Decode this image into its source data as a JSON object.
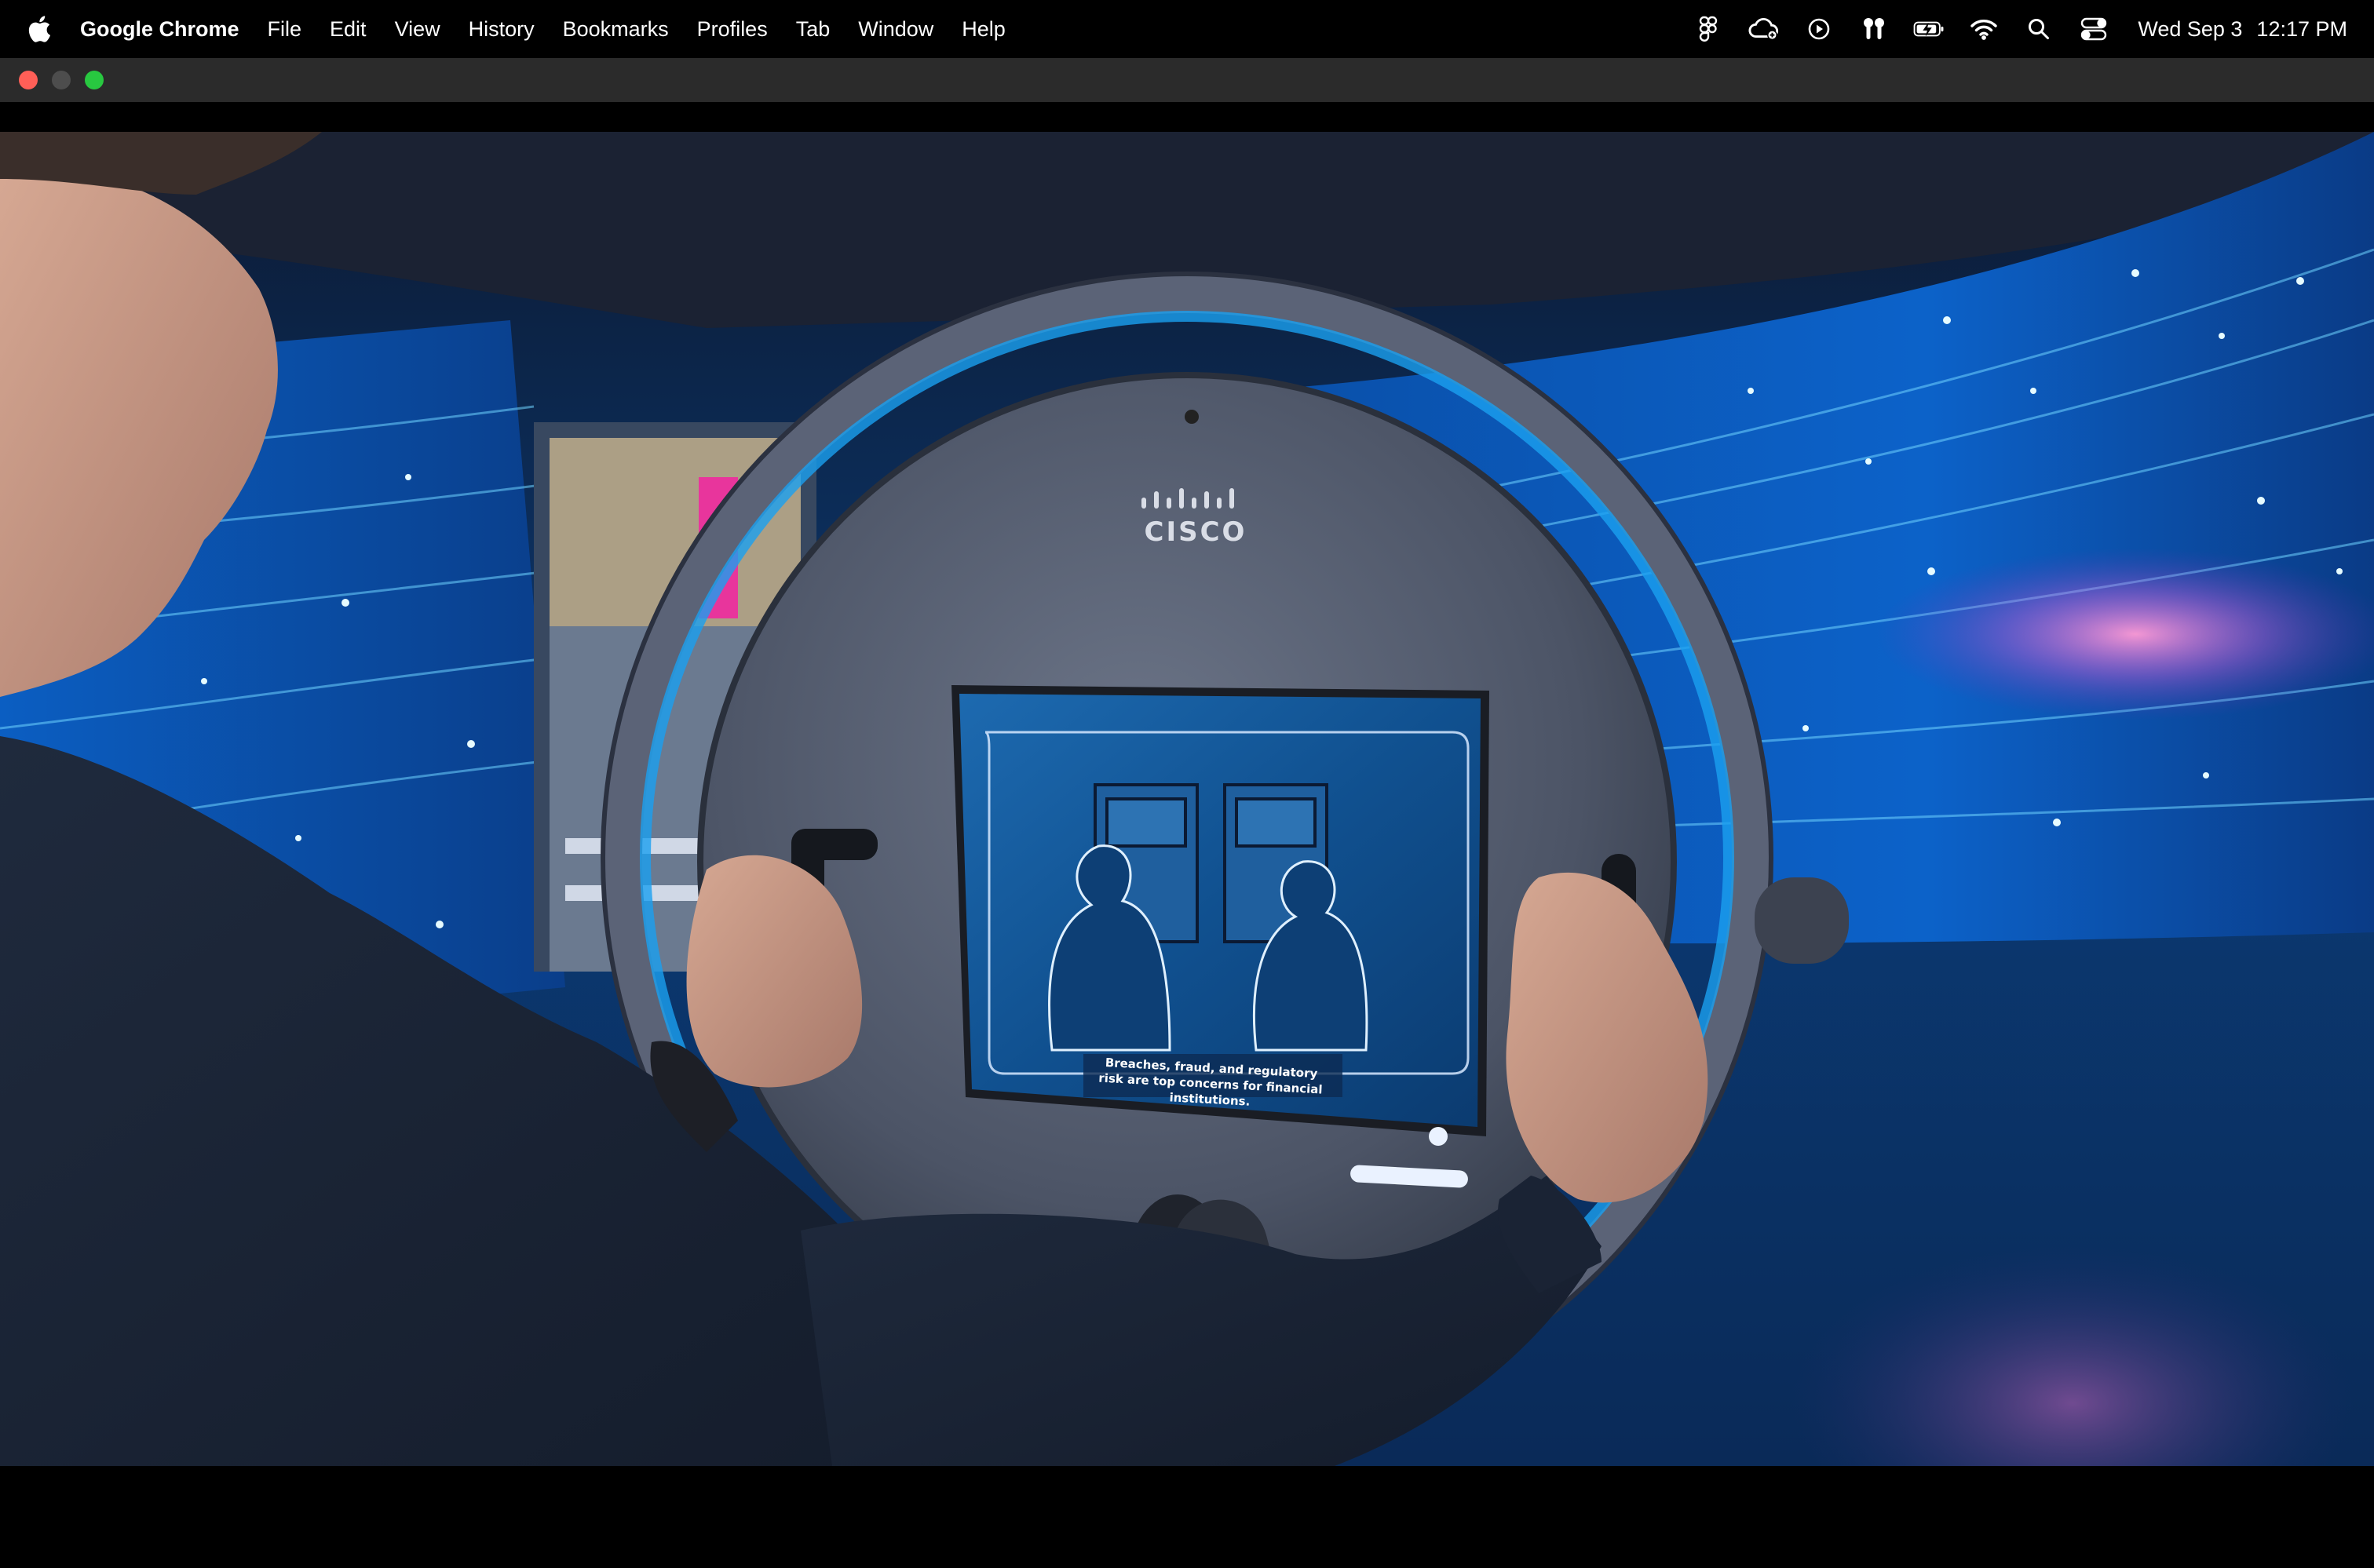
{
  "menubar": {
    "app_name": "Google Chrome",
    "menus": [
      "File",
      "Edit",
      "View",
      "History",
      "Bookmarks",
      "Profiles",
      "Tab",
      "Window",
      "Help"
    ],
    "status_icons": [
      "figma-icon",
      "creative-cloud-icon",
      "play-circle-icon",
      "airpods-icon",
      "battery-charging-icon",
      "wifi-icon",
      "search-icon",
      "control-center-icon"
    ],
    "date": "Wed Sep 3",
    "time": "12:17 PM"
  },
  "window": {
    "controls": [
      "close",
      "minimize",
      "zoom"
    ],
    "colors": {
      "close": "#ff5f57",
      "minimize": "#4d4d4d",
      "zoom": "#28c840"
    }
  },
  "video": {
    "logo_text": "CISCO",
    "screen_caption": "Breaches, fraud, and regulatory risk are top concerns for financial institutions."
  }
}
